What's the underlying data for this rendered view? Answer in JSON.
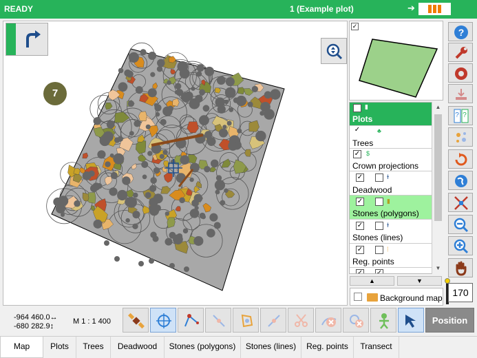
{
  "titlebar": {
    "status": "READY",
    "plot_name": "1 (Example plot)",
    "arrow": "➔"
  },
  "map": {
    "count_badge": "7"
  },
  "layers": [
    {
      "name": "Plots",
      "checked": true,
      "state": "active"
    },
    {
      "name": "Trees",
      "checked": true,
      "state": ""
    },
    {
      "name": "Crown projections",
      "checked": true,
      "state": ""
    },
    {
      "name": "Deadwood",
      "checked": true,
      "state": ""
    },
    {
      "name": "Stones (polygons)",
      "checked": true,
      "state": "selected"
    },
    {
      "name": "Stones (lines)",
      "checked": true,
      "state": ""
    },
    {
      "name": "Reg. points",
      "checked": true,
      "state": ""
    }
  ],
  "background_map": {
    "label": "Background map",
    "checked": false
  },
  "zoom_level": "170",
  "status": {
    "coord_x": "-964 460.0",
    "coord_y": "-680 282.9",
    "scale": "M 1 : 1 400"
  },
  "toolbar": {
    "position_label": "Position"
  },
  "tabs": [
    "Map",
    "Plots",
    "Trees",
    "Deadwood",
    "Stones (polygons)",
    "Stones (lines)",
    "Reg. points",
    "Transect"
  ],
  "colors": {
    "accent": "#27b35a",
    "selected_layer": "#9ef29e",
    "plot_fill": "#a8a8a8",
    "badge": "#6b6b3a"
  },
  "icons": {
    "undo": "redo-arrow-icon",
    "zoom_fit": "zoom-extent-icon",
    "right_tools": [
      "help-icon",
      "wrench-icon",
      "gear-icon",
      "import-icon",
      "help-dialog-icon",
      "sparkle-icon",
      "refresh-icon",
      "globe-icon",
      "fit-extent-icon",
      "zoom-out-icon",
      "zoom-in-icon",
      "pan-hand-icon"
    ],
    "bottom_tools": [
      "satellite-icon",
      "crosshair-icon",
      "add-vertex-icon",
      "move-vertex-icon",
      "edit-polygon-icon",
      "split-icon",
      "cut-icon",
      "delete-icon",
      "delete-point-icon",
      "person-icon",
      "select-arrow-icon"
    ]
  }
}
